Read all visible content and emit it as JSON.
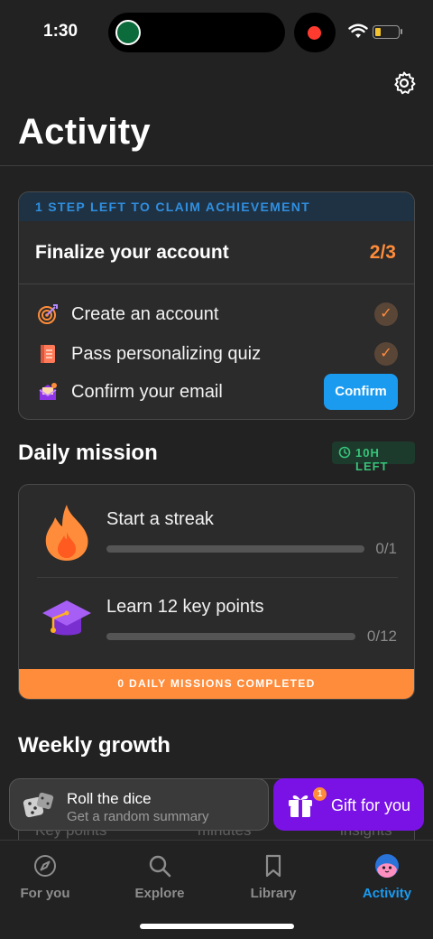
{
  "status_bar": {
    "time": "1:30"
  },
  "page_title": "Activity",
  "achievement": {
    "banner": "1 STEP LEFT TO CLAIM ACHIEVEMENT",
    "title": "Finalize your account",
    "progress": "2/3",
    "tasks": [
      {
        "label": "Create an account",
        "icon": "target-icon",
        "done": true
      },
      {
        "label": "Pass personalizing quiz",
        "icon": "notebook-icon",
        "done": true
      },
      {
        "label": "Confirm your email",
        "icon": "mailbox-icon",
        "done": false
      }
    ],
    "confirm_label": "Confirm"
  },
  "daily_mission": {
    "title": "Daily mission",
    "time_left": "10H LEFT",
    "missions": [
      {
        "label": "Start a streak",
        "count": "0/1",
        "progress": 0,
        "icon": "flame-icon"
      },
      {
        "label": "Learn 12 key points",
        "count": "0/12",
        "progress": 0,
        "icon": "graduation-cap-icon"
      }
    ],
    "footer": "0 DAILY MISSIONS COMPLETED"
  },
  "weekly_growth": {
    "title": "Weekly growth",
    "peek_labels": [
      "Key points",
      "minutes",
      "insights"
    ]
  },
  "floating": {
    "dice_title": "Roll the dice",
    "dice_subtitle": "Get a random summary",
    "gift_label": "Gift for you",
    "gift_badge": "1"
  },
  "tabs": [
    {
      "label": "For you",
      "icon": "compass-icon",
      "active": false
    },
    {
      "label": "Explore",
      "icon": "search-icon",
      "active": false
    },
    {
      "label": "Library",
      "icon": "bookmark-icon",
      "active": false
    },
    {
      "label": "Activity",
      "icon": "avatar-icon",
      "active": true
    }
  ],
  "colors": {
    "background": "#222222",
    "accent_orange": "#ff8c3a",
    "accent_blue": "#1a9bf0",
    "accent_green": "#37c47a",
    "gift_purple": "#7a12e6"
  }
}
